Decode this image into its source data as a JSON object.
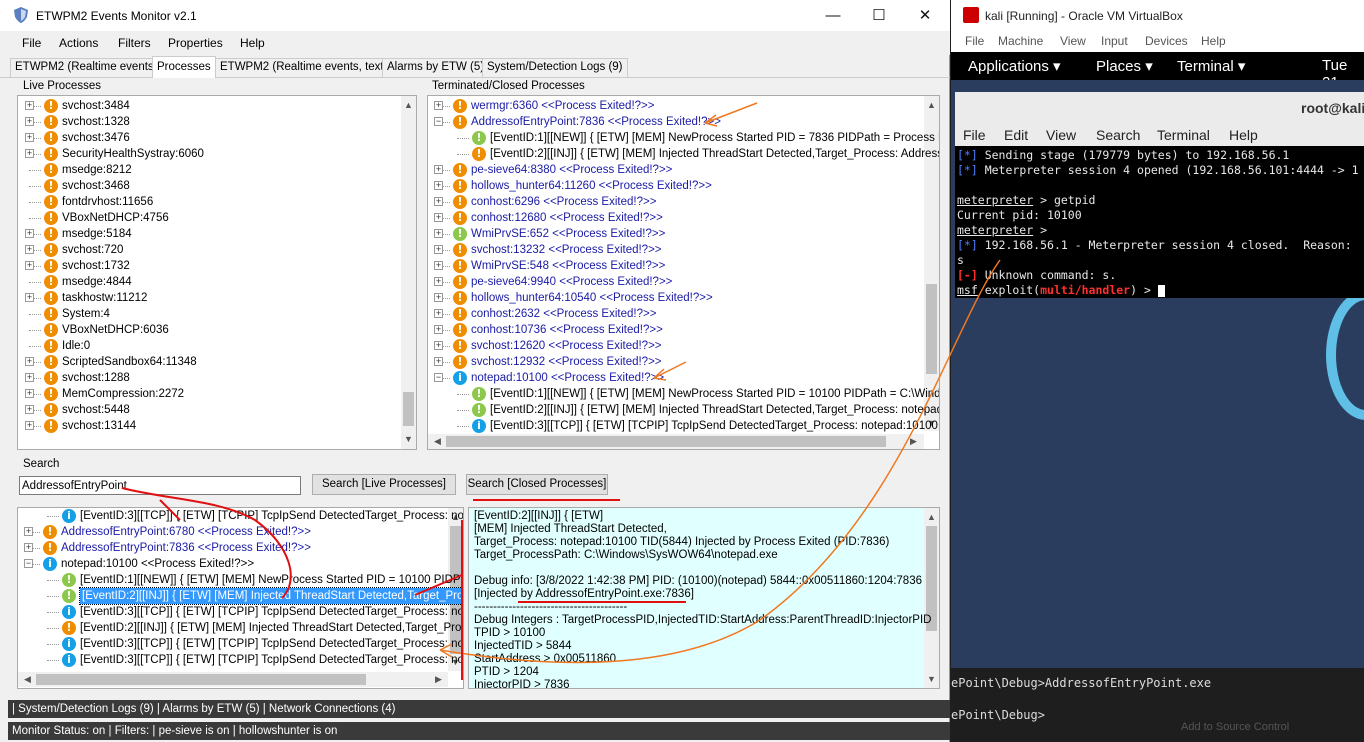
{
  "window": {
    "title": "ETWPM2 Events Monitor v2.1",
    "minimize": "—",
    "maximize": "☐",
    "close": "✕"
  },
  "menu": [
    "File",
    "Actions",
    "Filters",
    "Properties",
    "Help"
  ],
  "tabs": [
    "ETWPM2 (Realtime events)",
    "Processes",
    "ETWPM2 (Realtime events, text)",
    "Alarms by ETW (5)",
    "System/Detection Logs (9)"
  ],
  "live": {
    "label": "Live Processes",
    "rows": [
      {
        "text": "svchost:3484",
        "icon": "orange",
        "exp": true
      },
      {
        "text": "svchost:1328",
        "icon": "orange",
        "exp": true
      },
      {
        "text": "svchost:3476",
        "icon": "orange",
        "exp": true
      },
      {
        "text": "SecurityHealthSystray:6060",
        "icon": "orange",
        "exp": true
      },
      {
        "text": "msedge:8212",
        "icon": "orange",
        "exp": false
      },
      {
        "text": "svchost:3468",
        "icon": "orange",
        "exp": false
      },
      {
        "text": "fontdrvhost:11656",
        "icon": "orange",
        "exp": false
      },
      {
        "text": "VBoxNetDHCP:4756",
        "icon": "orange",
        "exp": false
      },
      {
        "text": "msedge:5184",
        "icon": "orange",
        "exp": true
      },
      {
        "text": "svchost:720",
        "icon": "orange",
        "exp": true
      },
      {
        "text": "svchost:1732",
        "icon": "orange",
        "exp": true
      },
      {
        "text": "msedge:4844",
        "icon": "orange",
        "exp": false
      },
      {
        "text": "taskhostw:11212",
        "icon": "orange",
        "exp": true
      },
      {
        "text": "System:4",
        "icon": "orange",
        "exp": false
      },
      {
        "text": "VBoxNetDHCP:6036",
        "icon": "orange",
        "exp": false
      },
      {
        "text": "Idle:0",
        "icon": "orange",
        "exp": false
      },
      {
        "text": "ScriptedSandbox64:11348",
        "icon": "orange",
        "exp": true
      },
      {
        "text": "svchost:1288",
        "icon": "orange",
        "exp": true
      },
      {
        "text": "MemCompression:2272",
        "icon": "orange",
        "exp": true
      },
      {
        "text": "svchost:5448",
        "icon": "orange",
        "exp": true
      },
      {
        "text": "svchost:13144",
        "icon": "orange",
        "exp": true
      }
    ]
  },
  "closed": {
    "label": "Terminated/Closed Processes",
    "rows": [
      {
        "text": "wermgr:6360 <<Process Exited!?>>",
        "icon": "orange",
        "exp": "+",
        "indent": 0
      },
      {
        "text": "AddressofEntryPoint:7836 <<Process Exited!?>>",
        "icon": "orange",
        "exp": "−",
        "indent": 0
      },
      {
        "text": "[EventID:1][[NEW]] { [ETW] [MEM] NewProcess Started PID = 7836  PIDPath = Process E",
        "icon": "green",
        "exp": "",
        "indent": 1
      },
      {
        "text": "[EventID:2][[INJ]] { [ETW] [MEM] Injected ThreadStart Detected,Target_Process: Addresso",
        "icon": "orange",
        "exp": "",
        "indent": 1
      },
      {
        "text": "pe-sieve64:8380 <<Process Exited!?>>",
        "icon": "orange",
        "exp": "+",
        "indent": 0
      },
      {
        "text": "hollows_hunter64:11260 <<Process Exited!?>>",
        "icon": "orange",
        "exp": "+",
        "indent": 0
      },
      {
        "text": "conhost:6296 <<Process Exited!?>>",
        "icon": "orange",
        "exp": "+",
        "indent": 0
      },
      {
        "text": "conhost:12680 <<Process Exited!?>>",
        "icon": "orange",
        "exp": "+",
        "indent": 0
      },
      {
        "text": "WmiPrvSE:652 <<Process Exited!?>>",
        "icon": "green",
        "exp": "+",
        "indent": 0
      },
      {
        "text": "svchost:13232 <<Process Exited!?>>",
        "icon": "orange",
        "exp": "+",
        "indent": 0
      },
      {
        "text": "WmiPrvSE:548 <<Process Exited!?>>",
        "icon": "orange",
        "exp": "+",
        "indent": 0
      },
      {
        "text": "pe-sieve64:9940 <<Process Exited!?>>",
        "icon": "orange",
        "exp": "+",
        "indent": 0
      },
      {
        "text": "hollows_hunter64:10540 <<Process Exited!?>>",
        "icon": "orange",
        "exp": "+",
        "indent": 0
      },
      {
        "text": "conhost:2632 <<Process Exited!?>>",
        "icon": "orange",
        "exp": "+",
        "indent": 0
      },
      {
        "text": "conhost:10736 <<Process Exited!?>>",
        "icon": "orange",
        "exp": "+",
        "indent": 0
      },
      {
        "text": "svchost:12620 <<Process Exited!?>>",
        "icon": "orange",
        "exp": "+",
        "indent": 0
      },
      {
        "text": "svchost:12932 <<Process Exited!?>>",
        "icon": "orange",
        "exp": "+",
        "indent": 0
      },
      {
        "text": "notepad:10100 <<Process Exited!?>>",
        "icon": "blue",
        "exp": "−",
        "indent": 0
      },
      {
        "text": "[EventID:1][[NEW]] { [ETW] [MEM] NewProcess Started PID = 10100  PIDPath = C:\\Windo",
        "icon": "green",
        "exp": "",
        "indent": 1
      },
      {
        "text": "[EventID:2][[INJ]] { [ETW] [MEM] Injected ThreadStart Detected,Target_Process: notepad:",
        "icon": "green",
        "exp": "",
        "indent": 1
      },
      {
        "text": "[EventID:3][[TCP]] { [ETW] [TCPIP] TcpIpSend DetectedTarget_Process: notepad:10100",
        "icon": "blue",
        "exp": "",
        "indent": 1
      }
    ]
  },
  "search": {
    "label": "Search",
    "value": "AddressofEntryPoint",
    "live_button": "Search [Live Processes]",
    "closed_button": "Search [Closed Processes]"
  },
  "results": {
    "rows": [
      {
        "text": "[EventID:3][[TCP]] { [ETW] [TCPIP] TcpIpSend DetectedTarget_Process: note",
        "icon": "blue",
        "exp": "",
        "indent": 1,
        "link": false,
        "sel": false
      },
      {
        "text": "AddressofEntryPoint:6780 <<Process Exited!?>>",
        "icon": "orange",
        "exp": "+",
        "indent": 0,
        "link": true,
        "sel": false
      },
      {
        "text": "AddressofEntryPoint:7836 <<Process Exited!?>>",
        "icon": "orange",
        "exp": "+",
        "indent": 0,
        "link": true,
        "sel": false
      },
      {
        "text": "notepad:10100 <<Process Exited!?>>",
        "icon": "blue",
        "exp": "−",
        "indent": 0,
        "link": false,
        "sel": false
      },
      {
        "text": "[EventID:1][[NEW]] { [ETW] [MEM] NewProcess Started PID = 10100  PIDPat",
        "icon": "green",
        "exp": "",
        "indent": 1,
        "link": false,
        "sel": false
      },
      {
        "text": "[EventID:2][[INJ]] { [ETW] [MEM] Injected ThreadStart Detected,Target_Proce",
        "icon": "green",
        "exp": "",
        "indent": 1,
        "link": false,
        "sel": true
      },
      {
        "text": "[EventID:3][[TCP]] { [ETW] [TCPIP] TcpIpSend DetectedTarget_Process: note",
        "icon": "blue",
        "exp": "",
        "indent": 1,
        "link": false,
        "sel": false
      },
      {
        "text": "[EventID:2][[INJ]] { [ETW] [MEM] Injected ThreadStart Detected,Target_Proce",
        "icon": "orange",
        "exp": "",
        "indent": 1,
        "link": false,
        "sel": false
      },
      {
        "text": "[EventID:3][[TCP]] { [ETW] [TCPIP] TcpIpSend DetectedTarget_Process: note",
        "icon": "blue",
        "exp": "",
        "indent": 1,
        "link": false,
        "sel": false
      },
      {
        "text": "[EventID:3][[TCP]] { [ETW] [TCPIP] TcpIpSend DetectedTarget_Process: note",
        "icon": "blue",
        "exp": "",
        "indent": 1,
        "link": false,
        "sel": false
      }
    ]
  },
  "details": {
    "lines": [
      "[EventID:2][[INJ]] { [ETW]",
      "[MEM] Injected ThreadStart Detected,",
      "Target_Process: notepad:10100   TID(5844) Injected by Process Exited (PID:7836)",
      "Target_ProcessPath: C:\\Windows\\SysWOW64\\notepad.exe",
      "",
      "Debug info: [3/8/2022 1:42:38 PM] PID: (10100)(notepad) 5844::0x00511860:1204:7836",
      "[Injected by AddressofEntryPoint.exe:7836]",
      "----------------------------------------",
      "Debug Integers : TargetProcessPID,InjectedTID:StartAddress:ParentThreadID:InjectorPID",
      "TPID > 10100",
      "InjectedTID > 5844",
      "StartAddress > 0x00511860",
      "PTID > 1204",
      "InjectorPID > 7836"
    ]
  },
  "status": {
    "line1": "| System/Detection Logs (9)  | Alarms by ETW (5)  | Network Connections (4)",
    "line2": "Monitor Status: on  | Filters:  | pe-sieve is on   | hollowshunter is on"
  },
  "vbox": {
    "title": "kali [Running] - Oracle VM VirtualBox",
    "menu": [
      "File",
      "Machine",
      "View",
      "Input",
      "Devices",
      "Help"
    ],
    "gnome": {
      "applications": "Applications ▾",
      "places": "Places ▾",
      "terminal": "Terminal ▾",
      "clock": "Tue 21"
    },
    "terminal_title": "root@kali",
    "terminal_menu": [
      "File",
      "Edit",
      "View",
      "Search",
      "Terminal",
      "Help"
    ],
    "lines": {
      "l1_tag": "[*]",
      "l1_text": " Sending stage (179779 bytes) to 192.168.56.1",
      "l2_tag": "[*]",
      "l2_text": " Meterpreter session 4 opened (192.168.56.101:4444 -> 1",
      "l3_prompt": "meterpreter",
      "l3_text": " > getpid",
      "l4_text": "Current pid: 10100",
      "l5_prompt": "meterpreter",
      "l5_text": " >",
      "l6_tag": "[*]",
      "l6_text": " 192.168.56.1 - Meterpreter session 4 closed.  Reason: ",
      "l7_text": "s",
      "l8_tag": "[-]",
      "l8_text": " Unknown command: s.",
      "l9_prompt": "msf",
      "l9_mid": " exploit(",
      "l9_mod": "multi/handler",
      "l9_end": ") > "
    }
  },
  "ps_lines": [
    "ePoint\\Debug>AddressofEntryPoint.exe",
    "ePoint\\Debug>"
  ],
  "vscode_hint": "Add to Source Control"
}
